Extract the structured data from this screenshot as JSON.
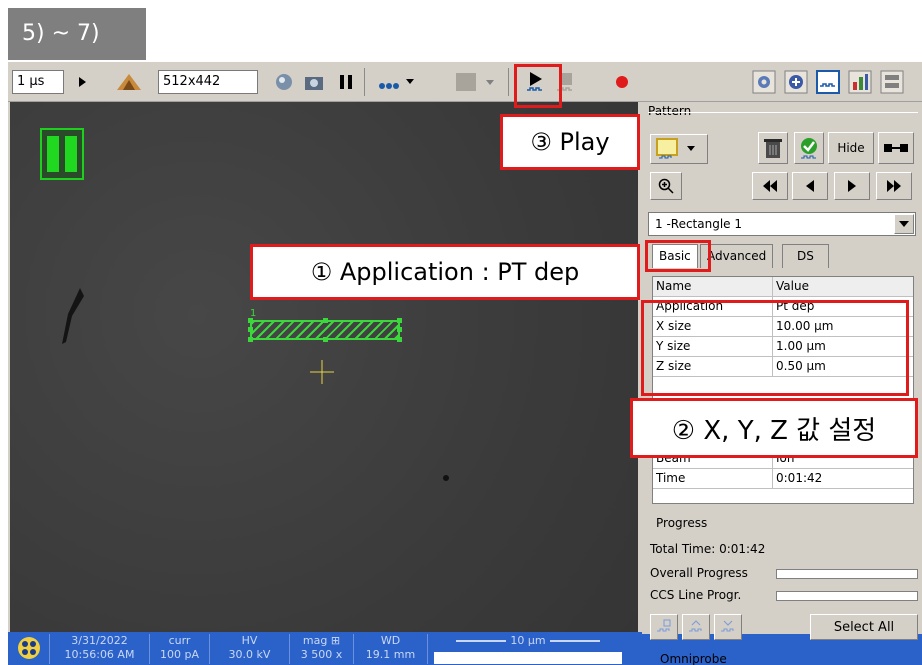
{
  "slide_label": "5) ~ 7)",
  "toolbar": {
    "dwell_time": "1 µs",
    "resolution": "512x442"
  },
  "status_bar": {
    "date": "3/31/2022",
    "time": "10:56:06 AM",
    "curr_label": "curr",
    "curr_value": "100 pA",
    "hv_label": "HV",
    "hv_value": "30.0 kV",
    "mag_label": "mag ⊞",
    "mag_value": "3 500 x",
    "wd_label": "WD",
    "wd_value": "19.1 mm",
    "scale_bar": "10 µm"
  },
  "panel": {
    "pattern_group": "Pattern",
    "hide_label": "Hide",
    "pattern_selected": "1 -Rectangle 1",
    "tabs": [
      "Basic",
      "Advanced",
      "DS"
    ],
    "table_headers": {
      "name": "Name",
      "value": "Value"
    },
    "rows": [
      {
        "name": "Application",
        "value": "Pt dep"
      },
      {
        "name": "X size",
        "value": "10.00 µm"
      },
      {
        "name": "Y size",
        "value": "1.00 µm"
      },
      {
        "name": "Z size",
        "value": "0.50 µm"
      }
    ],
    "rows_bottom": [
      {
        "name": "Beam",
        "value": "Ion"
      },
      {
        "name": "Time",
        "value": "0:01:42"
      }
    ],
    "progress_group": "Progress",
    "total_time": "Total Time:  0:01:42",
    "overall_progress": "Overall Progress",
    "ccs_progress": "CCS Line Progr.",
    "select_all": "Select All",
    "omniprobe": "Omniprobe"
  },
  "view": {
    "pattern_number": "1"
  },
  "callouts": {
    "play": "③ Play",
    "application": "① Application : PT dep",
    "xyz": "② X, Y, Z 값 설정"
  },
  "colors": {
    "callout_border": "#e01b1b",
    "pattern_green": "#3bd83b",
    "status_blue": "#2b62c9"
  }
}
